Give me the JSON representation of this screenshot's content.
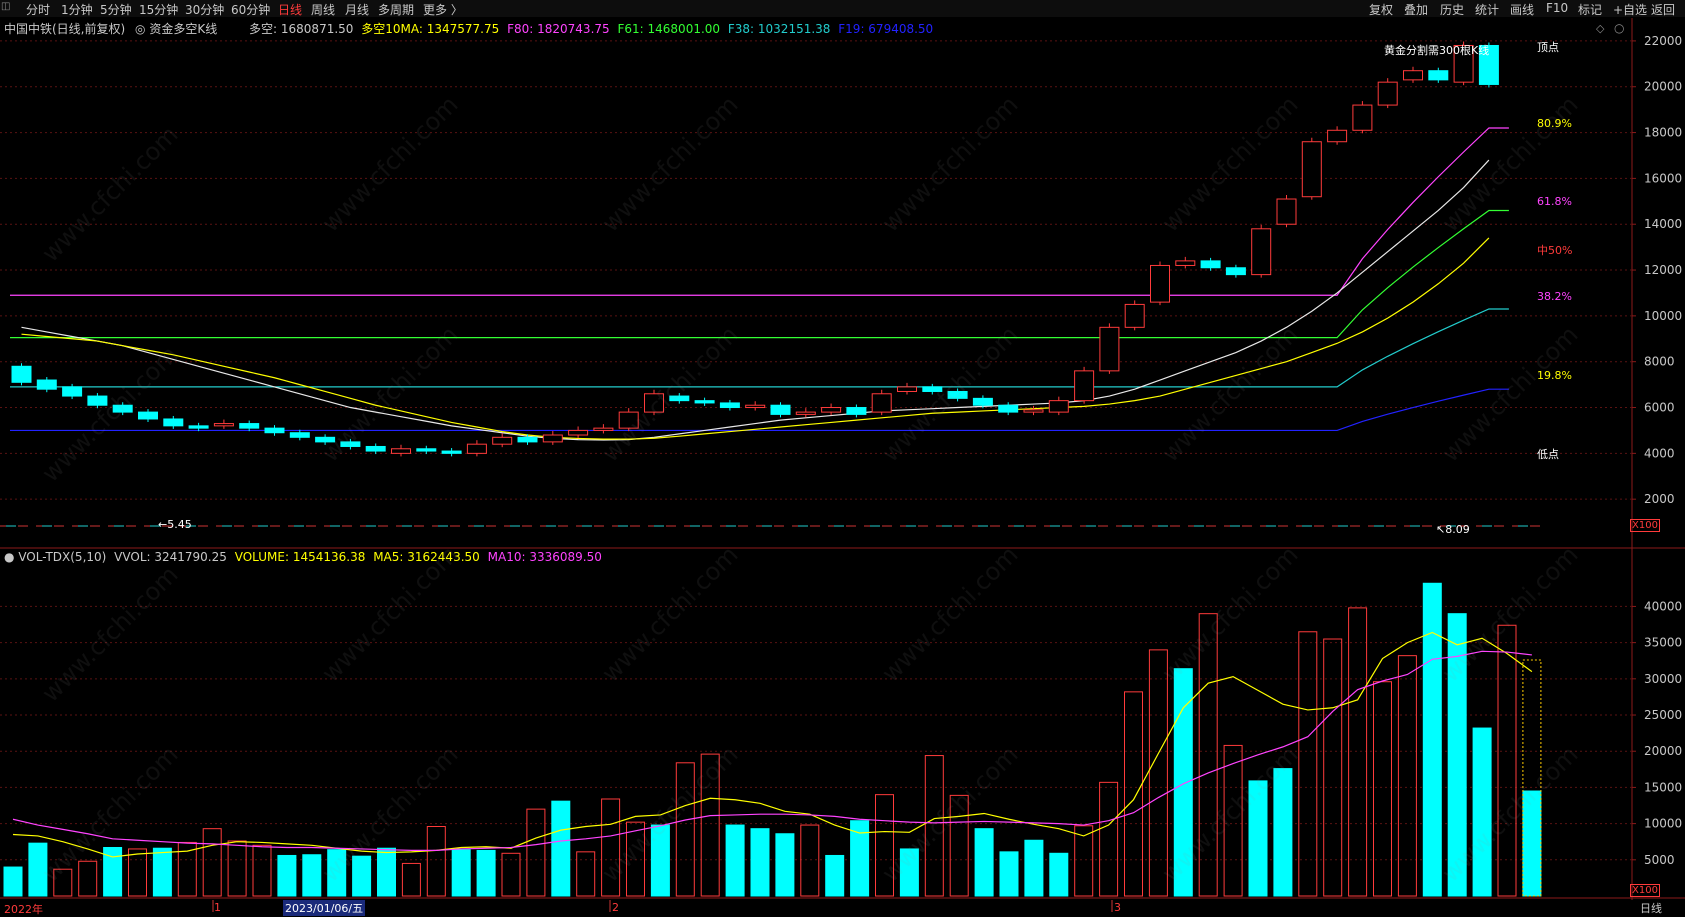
{
  "toolbar": {
    "tabs": [
      {
        "id": "fenshi",
        "label": "分时"
      },
      {
        "id": "1min",
        "label": "1分钟"
      },
      {
        "id": "5min",
        "label": "5分钟"
      },
      {
        "id": "15min",
        "label": "15分钟"
      },
      {
        "id": "30min",
        "label": "30分钟"
      },
      {
        "id": "60min",
        "label": "60分钟"
      },
      {
        "id": "day",
        "label": "日线",
        "active": true
      },
      {
        "id": "week",
        "label": "周线"
      },
      {
        "id": "month",
        "label": "月线"
      },
      {
        "id": "multi",
        "label": "多周期"
      },
      {
        "id": "more",
        "label": "更多 〉"
      }
    ],
    "right": [
      "复权",
      "叠加",
      "历史",
      "统计",
      "画线",
      "F10",
      "标记",
      "+自选",
      "返回"
    ]
  },
  "main_legend": {
    "stock": "中国中铁(日线,前复权)",
    "indicator": "资金多空K线",
    "duokong": "多空: 1680871.50",
    "ma10": "多空10MA: 1347577.75",
    "f80": "F80: 1820743.75",
    "f61": "F61: 1468001.00",
    "f38": "F38: 1032151.38",
    "f19": "F19: 679408.50"
  },
  "vol_legend": {
    "name": "VOL-TDX(5,10)",
    "vvol": "VVOL: 3241790.25",
    "volume": "VOLUME: 1454136.38",
    "ma5": "MA5: 3162443.50",
    "ma10": "MA10: 3336089.50"
  },
  "annotations": {
    "golden": "黄金分割需300根K线",
    "high": "顶点",
    "low": "低点",
    "pct809": "80.9%",
    "pct618": "61.8%",
    "pct50": "中50%",
    "pct382": "38.2%",
    "pct198": "19.8%",
    "left_marker": "5.45",
    "right_marker": "8.09",
    "x100_top": "X100",
    "x100_bottom": "X100"
  },
  "bottom_axis": {
    "year": "2022年",
    "m1": "1",
    "cursor_date": "2023/01/06/五",
    "m2": "2",
    "m3": "3",
    "period_label": "日线"
  },
  "watermark": "www.cfchi.com",
  "colors": {
    "up": "#ff3b3b",
    "down": "#00ffff",
    "ma_white": "#e8e8e8",
    "ma_yellow": "#ffff00",
    "magenta": "#ff44ff",
    "green": "#33ff33",
    "cyan_line": "#22cccc",
    "blue": "#2222ff"
  },
  "chart_data": [
    {
      "type": "candlestick",
      "title": "资金多空K线",
      "ylim": [
        0,
        23000
      ],
      "yticks": [
        2000,
        4000,
        6000,
        8000,
        10000,
        12000,
        14000,
        16000,
        18000,
        20000,
        22000
      ],
      "ytick_labels": [
        "2000",
        "4000",
        "6000",
        "8000",
        "10000",
        "12000",
        "14000",
        "16000",
        "18000",
        "20000",
        "22000"
      ],
      "candles": [
        {
          "o": 7800,
          "c": 7100
        },
        {
          "o": 7200,
          "c": 6800
        },
        {
          "o": 6900,
          "c": 6500
        },
        {
          "o": 6500,
          "c": 6100
        },
        {
          "o": 6100,
          "c": 5800
        },
        {
          "o": 5800,
          "c": 5500
        },
        {
          "o": 5500,
          "c": 5200
        },
        {
          "o": 5200,
          "c": 5100
        },
        {
          "o": 5200,
          "c": 5300
        },
        {
          "o": 5300,
          "c": 5100
        },
        {
          "o": 5100,
          "c": 4900
        },
        {
          "o": 4900,
          "c": 4700
        },
        {
          "o": 4700,
          "c": 4500
        },
        {
          "o": 4500,
          "c": 4300
        },
        {
          "o": 4300,
          "c": 4100
        },
        {
          "o": 4000,
          "c": 4200
        },
        {
          "o": 4200,
          "c": 4100
        },
        {
          "o": 4100,
          "c": 4000
        },
        {
          "o": 4000,
          "c": 4400
        },
        {
          "o": 4400,
          "c": 4700
        },
        {
          "o": 4700,
          "c": 4500
        },
        {
          "o": 4500,
          "c": 4800
        },
        {
          "o": 4800,
          "c": 5000
        },
        {
          "o": 5000,
          "c": 5100
        },
        {
          "o": 5100,
          "c": 5800
        },
        {
          "o": 5800,
          "c": 6600
        },
        {
          "o": 6500,
          "c": 6300
        },
        {
          "o": 6300,
          "c": 6200
        },
        {
          "o": 6200,
          "c": 6000
        },
        {
          "o": 6000,
          "c": 6100
        },
        {
          "o": 6100,
          "c": 5700
        },
        {
          "o": 5700,
          "c": 5800
        },
        {
          "o": 5800,
          "c": 6000
        },
        {
          "o": 6000,
          "c": 5700
        },
        {
          "o": 5800,
          "c": 6600
        },
        {
          "o": 6700,
          "c": 6900
        },
        {
          "o": 6900,
          "c": 6700
        },
        {
          "o": 6700,
          "c": 6400
        },
        {
          "o": 6400,
          "c": 6100
        },
        {
          "o": 6100,
          "c": 5800
        },
        {
          "o": 5800,
          "c": 5900
        },
        {
          "o": 5800,
          "c": 6300
        },
        {
          "o": 6300,
          "c": 7600
        },
        {
          "o": 7600,
          "c": 9500
        },
        {
          "o": 9500,
          "c": 10500
        },
        {
          "o": 10600,
          "c": 12200
        },
        {
          "o": 12200,
          "c": 12400
        },
        {
          "o": 12400,
          "c": 12100
        },
        {
          "o": 12100,
          "c": 11800
        },
        {
          "o": 11800,
          "c": 13800
        },
        {
          "o": 14000,
          "c": 15100
        },
        {
          "o": 15200,
          "c": 17600
        },
        {
          "o": 17600,
          "c": 18100
        },
        {
          "o": 18100,
          "c": 19200
        },
        {
          "o": 19200,
          "c": 20200
        },
        {
          "o": 20300,
          "c": 20700
        },
        {
          "o": 20700,
          "c": 20300
        },
        {
          "o": 20200,
          "c": 21800
        },
        {
          "o": 21800,
          "c": 20100
        }
      ],
      "levels": [
        {
          "name": "high",
          "value": 21800
        },
        {
          "name": "80.9%",
          "value": 18200
        },
        {
          "name": "61.8%",
          "value": 14600
        },
        {
          "name": "中50%",
          "value": 12200
        },
        {
          "name": "38.2%",
          "value": 10300
        },
        {
          "name": "19.8%",
          "value": 6800
        },
        {
          "name": "low",
          "value": 4000
        }
      ],
      "ma_white": [
        9500,
        9300,
        9100,
        8900,
        8700,
        8400,
        8100,
        7800,
        7500,
        7200,
        6900,
        6600,
        6300,
        6000,
        5800,
        5600,
        5400,
        5200,
        5050,
        4900,
        4750,
        4650,
        4600,
        4580,
        4600,
        4700,
        4850,
        5000,
        5150,
        5300,
        5450,
        5550,
        5650,
        5750,
        5850,
        5900,
        5950,
        6000,
        6050,
        6100,
        6150,
        6200,
        6300,
        6500,
        6800,
        7200,
        7600,
        8000,
        8400,
        8900,
        9500,
        10200,
        11000,
        11900,
        12800,
        13700,
        14600,
        15600,
        16800
      ],
      "ma_yellow": [
        9200,
        9100,
        9000,
        8900,
        8700,
        8500,
        8300,
        8050,
        7800,
        7550,
        7300,
        7000,
        6700,
        6400,
        6100,
        5850,
        5600,
        5350,
        5150,
        4950,
        4800,
        4700,
        4650,
        4620,
        4620,
        4660,
        4750,
        4850,
        4950,
        5050,
        5150,
        5250,
        5350,
        5450,
        5550,
        5650,
        5750,
        5800,
        5850,
        5900,
        5950,
        6000,
        6050,
        6150,
        6300,
        6500,
        6800,
        7100,
        7400,
        7700,
        8000,
        8400,
        8800,
        9300,
        9900,
        10600,
        11400,
        12300,
        13400
      ]
    },
    {
      "type": "bar",
      "title": "VOL-TDX(5,10)",
      "ylim": [
        0,
        46000
      ],
      "yticks": [
        5000,
        10000,
        15000,
        20000,
        25000,
        30000,
        35000,
        40000
      ],
      "ytick_labels": [
        "5000",
        "10000",
        "15000",
        "20000",
        "25000",
        "30000",
        "35000",
        "40000"
      ],
      "values": [
        4000,
        7300,
        3700,
        4800,
        6700,
        6500,
        6600,
        7400,
        9300,
        7600,
        7000,
        5600,
        5700,
        6400,
        5500,
        6600,
        4500,
        9600,
        6400,
        6300,
        5900,
        12000,
        13100,
        6100,
        13400,
        10200,
        9800,
        18400,
        19600,
        9800,
        9300,
        8600,
        9800,
        5600,
        10400,
        14000,
        6500,
        19400,
        13900,
        9300,
        6100,
        7700,
        5900,
        9700,
        15700,
        28200,
        34000,
        31400,
        39000,
        20800,
        15900,
        17600,
        36500,
        35500,
        39800,
        29600,
        33200,
        43200,
        39000,
        23200,
        37400,
        14500
      ],
      "up": [
        false,
        false,
        true,
        true,
        false,
        true,
        false,
        true,
        true,
        true,
        true,
        false,
        false,
        false,
        false,
        false,
        true,
        true,
        false,
        false,
        true,
        true,
        false,
        true,
        true,
        true,
        false,
        true,
        true,
        false,
        false,
        false,
        true,
        false,
        false,
        true,
        false,
        true,
        true,
        false,
        false,
        false,
        false,
        true,
        true,
        true,
        true,
        false,
        true,
        true,
        false,
        false,
        true,
        true,
        true,
        true,
        true,
        false,
        false,
        false,
        true,
        false
      ],
      "ma5": [
        8500,
        8300,
        7500,
        6500,
        5400,
        5800,
        6000,
        6200,
        7000,
        7500,
        7400,
        7200,
        7000,
        6600,
        6200,
        6000,
        6100,
        6300,
        6700,
        6800,
        6600,
        8000,
        9100,
        9600,
        9900,
        11000,
        11200,
        12500,
        13500,
        13300,
        12800,
        11700,
        11300,
        9800,
        8700,
        8900,
        8800,
        10700,
        11000,
        11400,
        10600,
        9900,
        9300,
        8300,
        9800,
        13300,
        19700,
        26000,
        29400,
        30300,
        28400,
        26500,
        25700,
        26000,
        27100,
        32800,
        35000,
        36400,
        34700,
        35600,
        33500,
        31000
      ],
      "ma10": [
        10600,
        9800,
        9200,
        8600,
        7900,
        7700,
        7500,
        7300,
        7200,
        7000,
        6800,
        6700,
        6700,
        6600,
        6500,
        6400,
        6300,
        6300,
        6500,
        6600,
        6700,
        7100,
        7600,
        7900,
        8300,
        9000,
        9700,
        10500,
        11100,
        11200,
        11300,
        11300,
        11200,
        11000,
        10600,
        10400,
        10200,
        10100,
        10200,
        10300,
        10200,
        10100,
        10000,
        9800,
        10400,
        11500,
        13600,
        15500,
        17000,
        18300,
        19500,
        20600,
        22000,
        25500,
        28500,
        29700,
        30600,
        32700,
        33100,
        33800,
        33700,
        33300
      ]
    }
  ]
}
